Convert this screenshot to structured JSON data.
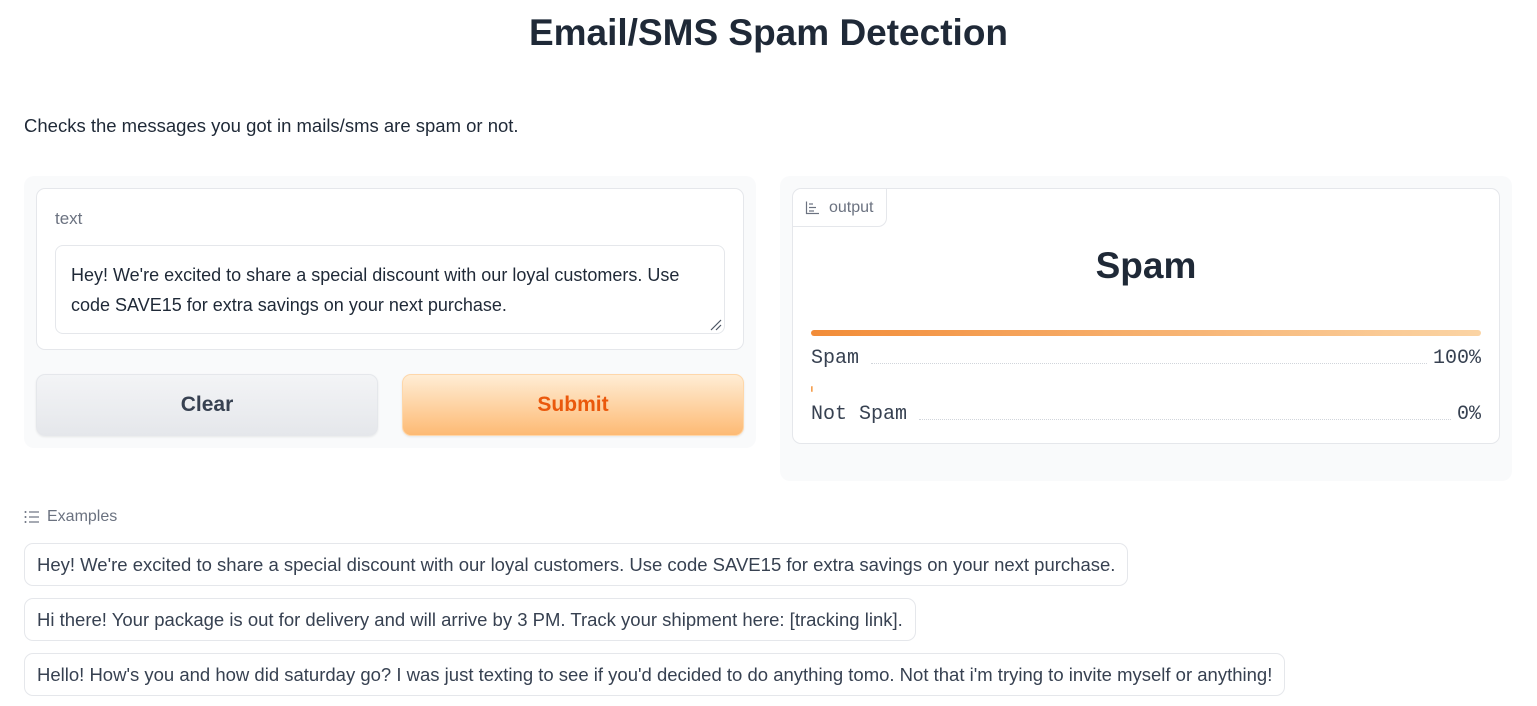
{
  "title": "Email/SMS Spam Detection",
  "description": "Checks the messages you got in mails/sms are spam or not.",
  "input": {
    "label": "text",
    "value": "Hey! We're excited to share a special discount with our loyal customers. Use code SAVE15 for extra savings on your next purchase."
  },
  "buttons": {
    "clear_label": "Clear",
    "submit_label": "Submit"
  },
  "output": {
    "tag_label": "output",
    "icon": "bar-chart-icon",
    "predicted_label": "Spam",
    "confidences": [
      {
        "label": "Spam",
        "percent_text": "100%",
        "fraction": 1.0
      },
      {
        "label": "Not Spam",
        "percent_text": "0%",
        "fraction": 0.0
      }
    ]
  },
  "examples": {
    "heading": "Examples",
    "icon": "list-icon",
    "items": [
      "Hey! We're excited to share a special discount with our loyal customers. Use code SAVE15 for extra savings on your next purchase.",
      "Hi there! Your package is out for delivery and will arrive by 3 PM. Track your shipment here: [tracking link].",
      "Hello! How's you and how did saturday go? I was just texting to see if you'd decided to do anything tomo. Not that i'm trying to invite myself or anything!"
    ]
  },
  "colors": {
    "accent": "#f97316",
    "submit_text": "#ea580c",
    "bar_start": "#f28c38",
    "bar_end": "#fbd4a4"
  }
}
